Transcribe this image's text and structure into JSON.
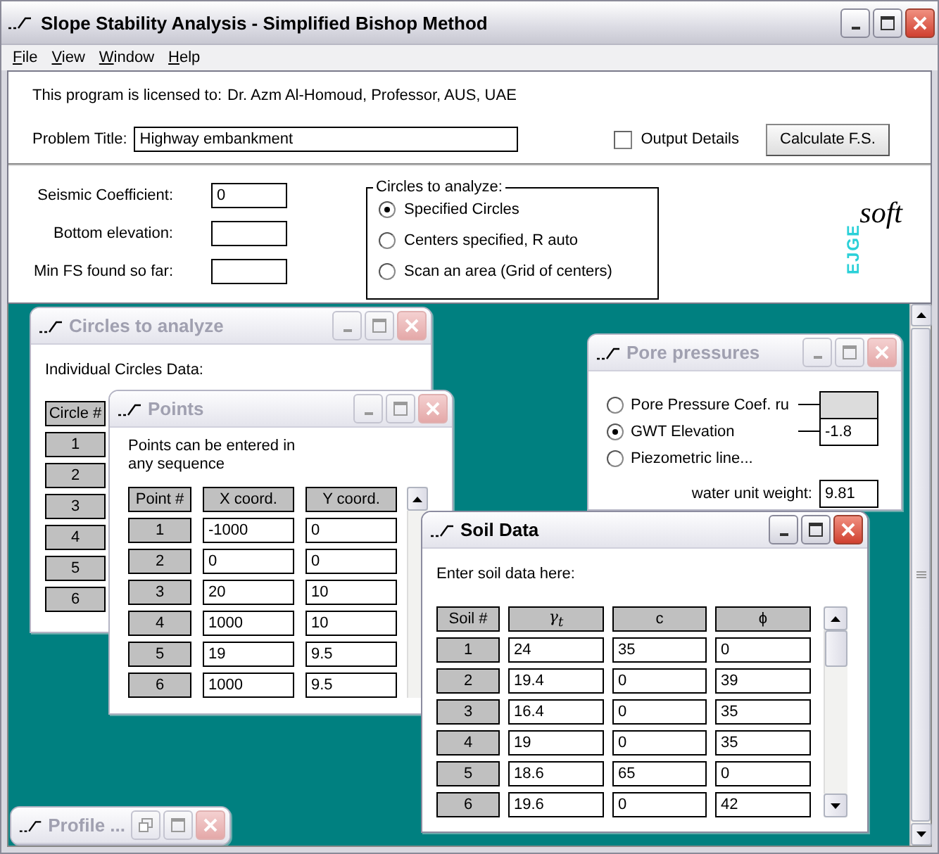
{
  "window": {
    "title": "Slope Stability Analysis - Simplified Bishop Method"
  },
  "menu": [
    {
      "label": "File"
    },
    {
      "label": "View"
    },
    {
      "label": "Window"
    },
    {
      "label": "Help"
    }
  ],
  "license": {
    "label": "This program is licensed to:",
    "value": "Dr. Azm Al-Homoud, Professor, AUS, UAE"
  },
  "problem_title": {
    "label": "Problem Title:",
    "value": "Highway embankment"
  },
  "output_details": {
    "label": "Output Details",
    "checked": false
  },
  "calculate_button": "Calculate F.S.",
  "parameters": [
    {
      "label": "Seismic Coefficient:",
      "value": "0"
    },
    {
      "label": "Bottom elevation:"
    },
    {
      "label": "Min FS found so far:"
    }
  ],
  "circles_group": {
    "title": "Circles to analyze:",
    "options": [
      {
        "label": "Specified Circles",
        "selected": true
      },
      {
        "label": "Centers specified, R auto",
        "selected": false
      },
      {
        "label": "Scan an area (Grid of centers)",
        "selected": false
      }
    ]
  },
  "logo": {
    "vertical": "EJGE",
    "word": "soft"
  },
  "circles_window": {
    "title": "Circles to analyze",
    "active": false,
    "caption": "Individual Circles Data:",
    "header": "Circle #",
    "rows": [
      "1",
      "2",
      "3",
      "4",
      "5",
      "6"
    ]
  },
  "points_window": {
    "title": "Points",
    "active": false,
    "caption": "Points can be entered in any sequence",
    "columns": [
      "Point #",
      "X coord.",
      "Y coord."
    ],
    "rows": [
      [
        "1",
        "-1000",
        "0"
      ],
      [
        "2",
        "0",
        "0"
      ],
      [
        "3",
        "20",
        "10"
      ],
      [
        "4",
        "1000",
        "10"
      ],
      [
        "5",
        "19",
        "9.5"
      ],
      [
        "6",
        "1000",
        "9.5"
      ]
    ]
  },
  "pore_window": {
    "title": "Pore pressures",
    "active": false,
    "options": [
      {
        "label": "Pore Pressure Coef. ru",
        "selected": false,
        "kind": "field",
        "disabled": true
      },
      {
        "label": "GWT Elevation",
        "selected": true,
        "kind": "field",
        "disabled": false,
        "value": "-1.8"
      },
      {
        "label": "Piezometric line...",
        "selected": false,
        "kind": "plain"
      }
    ],
    "water_weight": {
      "label": "water unit weight:",
      "value": "9.81"
    }
  },
  "soil_window": {
    "title": "Soil Data",
    "active": true,
    "caption": "Enter soil data here:",
    "columns": [
      "Soil #",
      "γ$_{t}$",
      "c",
      "ϕ"
    ],
    "rows": [
      [
        "1",
        "24",
        "35",
        "0"
      ],
      [
        "2",
        "19.4",
        "0",
        "39"
      ],
      [
        "3",
        "16.4",
        "0",
        "35"
      ],
      [
        "4",
        "19",
        "0",
        "35"
      ],
      [
        "5",
        "18.6",
        "65",
        "0"
      ],
      [
        "6",
        "19.6",
        "0",
        "42"
      ]
    ]
  },
  "profile_window": {
    "title": "Profile ...",
    "active": false
  }
}
